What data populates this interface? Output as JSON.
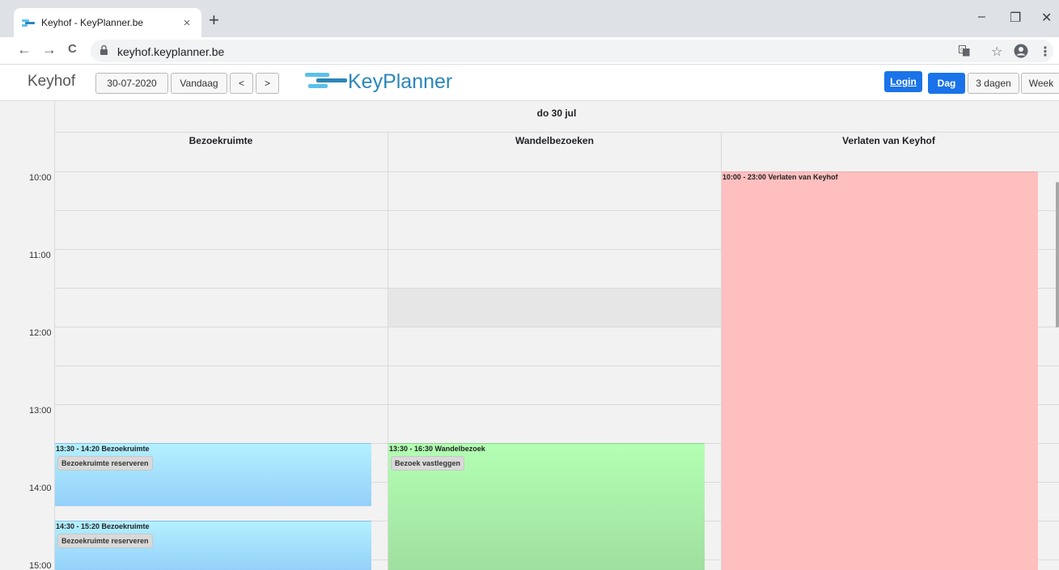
{
  "browser": {
    "tab_title": "Keyhof - KeyPlanner.be",
    "tab_close": "×",
    "new_tab": "+",
    "url": "keyhof.keyplanner.be",
    "window_controls": {
      "minimize": "–",
      "restore": "❐",
      "close": "✕"
    },
    "nav": {
      "back": "←",
      "forward": "→",
      "reload": "C"
    },
    "icons": {
      "translate": "translate-icon",
      "star": "☆",
      "profile": "profile-icon",
      "menu": "⋮"
    }
  },
  "app": {
    "title": "Keyhof",
    "date": "30-07-2020",
    "today_label": "Vandaag",
    "prev_label": "<",
    "next_label": ">",
    "logo_text": "KeyPlanner",
    "login_label": "Login",
    "views": [
      "Dag",
      "3 dagen",
      "Week"
    ],
    "active_view": "Dag"
  },
  "calendar": {
    "day_header": "do 30 jul",
    "columns": [
      "Bezoekruimte",
      "Wandelbezoeken",
      "Verlaten van Keyhof"
    ],
    "times": [
      "10:00",
      "11:00",
      "12:00",
      "13:00",
      "14:00",
      "15:00"
    ],
    "events": [
      {
        "column": "Bezoekruimte",
        "title": "13:30 - 14:20 Bezoekruimte",
        "button": "Bezoekruimte reserveren",
        "color": "#a6e2fc"
      },
      {
        "column": "Bezoekruimte",
        "title": "14:30 - 15:20 Bezoekruimte",
        "button": "Bezoekruimte reserveren",
        "color": "#a6e2fc"
      },
      {
        "column": "Wandelbezoeken",
        "title": "13:30 - 16:30 Wandelbezoek",
        "button": "Bezoek vastleggen",
        "color": "#a9f2a9"
      },
      {
        "column": "Verlaten van Keyhof",
        "title": "10:00 - 23:00 Verlaten van Keyhof",
        "button": "",
        "color": "#ffbfbf"
      }
    ]
  },
  "colors": {
    "accent": "#1a73e8",
    "logo": "#2b86b8"
  }
}
